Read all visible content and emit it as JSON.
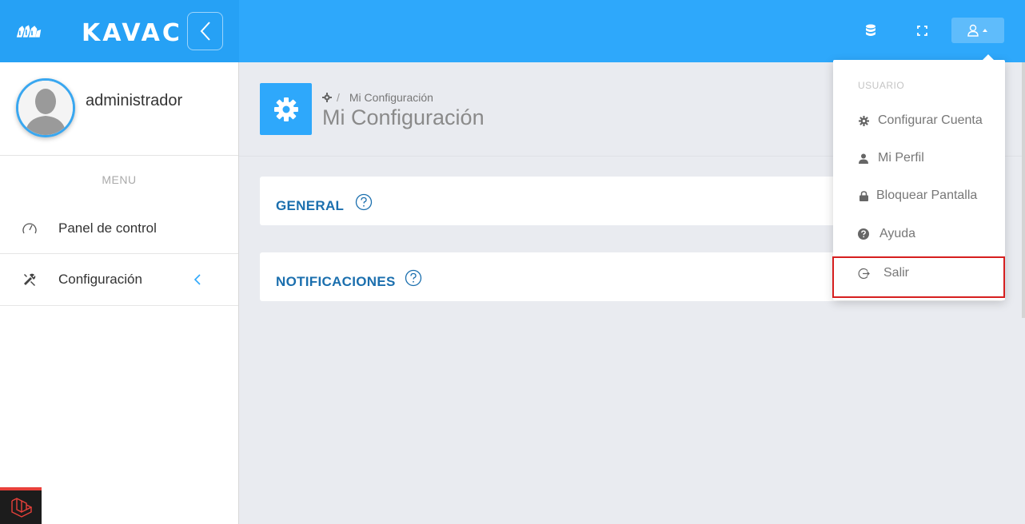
{
  "brand": {
    "name": "KAVAC"
  },
  "topbar": {
    "icons": [
      "database-icon",
      "fullscreen-icon",
      "user-icon"
    ]
  },
  "sidebar": {
    "username": "administrador",
    "menu_title": "MENU",
    "items": [
      {
        "label": "Panel de control",
        "icon": "speedometer-icon"
      },
      {
        "label": "Configuración",
        "icon": "tools-icon"
      }
    ]
  },
  "page": {
    "breadcrumb": "Mi Configuración",
    "title": "Mi Configuración"
  },
  "panels": [
    {
      "title": "GENERAL"
    },
    {
      "title": "NOTIFICACIONES"
    }
  ],
  "user_menu": {
    "header": "USUARIO",
    "items": [
      {
        "label": "Configurar Cuenta",
        "icon": "gear-icon"
      },
      {
        "label": "Mi Perfil",
        "icon": "user-icon"
      },
      {
        "label": "Bloquear Pantalla",
        "icon": "lock-icon"
      },
      {
        "label": "Ayuda",
        "icon": "question-icon"
      },
      {
        "label": "Salir",
        "icon": "logout-icon"
      }
    ]
  },
  "colors": {
    "primary": "#2ea8fb",
    "panel_title": "#1b6fae",
    "highlight": "#d61f1f"
  }
}
